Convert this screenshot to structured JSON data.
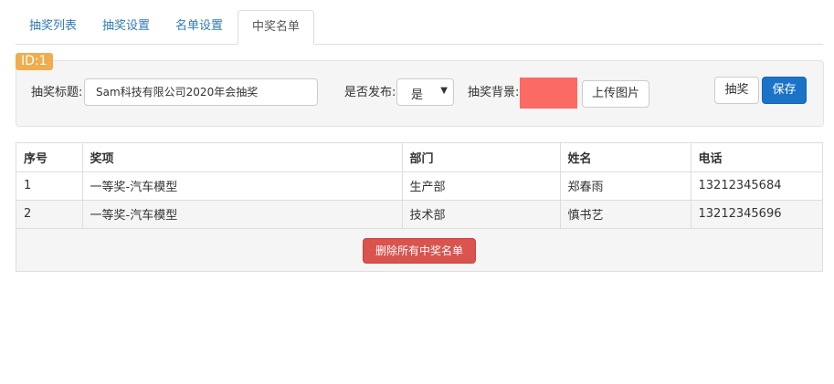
{
  "tabs": [
    "抽奖列表",
    "抽奖设置",
    "名单设置",
    "中奖名单"
  ],
  "active_tab": "中奖名单",
  "id_badge": "ID:1",
  "form": {
    "title_label": "抽奖标题:",
    "title_value": "Sam科技有限公司2020年会抽奖",
    "publish_label": "是否发布:",
    "publish_value": "是",
    "bg_label": "抽奖背景:",
    "bg_color": "#fb6b63",
    "upload_label": "上传图片"
  },
  "buttons": {
    "draw": "抽奖",
    "save": "保存",
    "delete_all": "删除所有中奖名单"
  },
  "table": {
    "headers": [
      "序号",
      "奖项",
      "部门",
      "姓名",
      "电话"
    ],
    "rows": [
      [
        "1",
        "一等奖-汽车模型",
        "生产部",
        "郑春雨",
        "13212345684"
      ],
      [
        "2",
        "一等奖-汽车模型",
        "技术部",
        "慎书艺",
        "13212345696"
      ]
    ]
  }
}
